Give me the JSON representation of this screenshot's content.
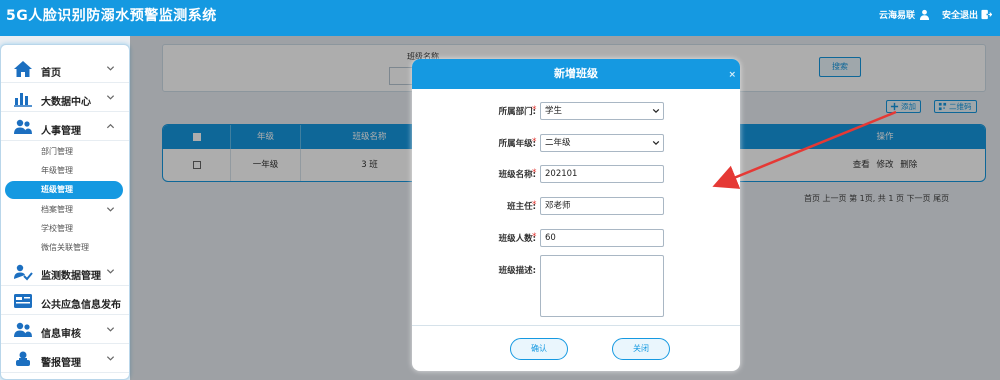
{
  "header": {
    "title": "5G人脸识别防溺水预警监测系统",
    "user": "云海易联",
    "logout": "安全退出"
  },
  "sidebar": {
    "menu": [
      {
        "label": "首页",
        "icon": "home-icon"
      },
      {
        "label": "大数据中心",
        "icon": "chart-icon"
      },
      {
        "label": "人事管理",
        "icon": "users-icon"
      },
      {
        "label": "监测数据管理",
        "icon": "data-monitor-icon"
      },
      {
        "label": "公共应急信息发布",
        "icon": "broadcast-icon"
      },
      {
        "label": "信息审核",
        "icon": "audit-icon"
      },
      {
        "label": "警报管理",
        "icon": "alarm-icon"
      }
    ],
    "submenu": [
      "部门管理",
      "年级管理",
      "班级管理",
      "档案管理",
      "学校管理",
      "微信关联管理"
    ]
  },
  "search": {
    "label": "班级名称",
    "button": "搜索"
  },
  "toolbar": {
    "add": "添加",
    "qrcode": "二维码"
  },
  "table": {
    "headers": [
      "",
      "年级",
      "班级名称",
      "操作"
    ],
    "rows": [
      {
        "grade": "一年级",
        "class_name": "3 班",
        "actions": [
          "查看",
          "修改",
          "删除"
        ]
      }
    ]
  },
  "pagination": {
    "text": "首页 上一页 第 1页, 共 1 页 下一页 尾页"
  },
  "modal": {
    "title": "新增班级",
    "close": "×",
    "fields": [
      {
        "label": "所属部门:",
        "value": "学生",
        "type": "select",
        "required": true
      },
      {
        "label": "所属年级:",
        "value": "二年级",
        "type": "select",
        "required": true
      },
      {
        "label": "班级名称:",
        "value": "202101",
        "type": "text",
        "required": true
      },
      {
        "label": "班主任:",
        "value": "邓老师",
        "type": "text",
        "required": true
      },
      {
        "label": "班级人数:",
        "value": "60",
        "type": "text",
        "required": true
      },
      {
        "label": "班级描述:",
        "value": "",
        "type": "textarea",
        "required": false
      }
    ],
    "required_mark": "*",
    "confirm": "确认",
    "close_button": "关闭"
  },
  "colors": {
    "primary": "#1599e1",
    "required": "#e0342f",
    "arrow": "#e53935"
  }
}
